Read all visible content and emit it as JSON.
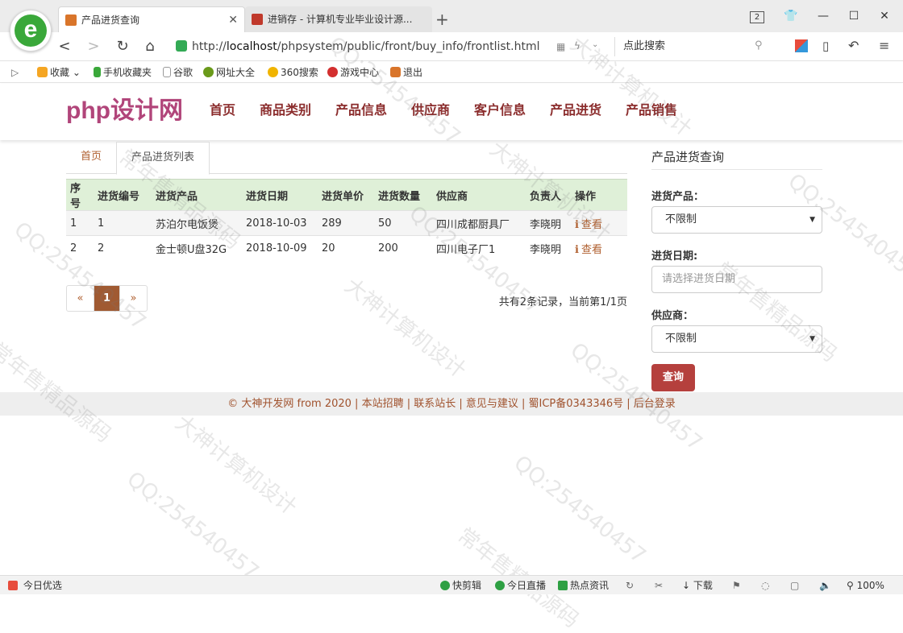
{
  "browser": {
    "tabs": [
      {
        "label": "产品进货查询",
        "favicon_color": "#d9752a"
      },
      {
        "label": "进销存 - 计算机专业毕业设计源...",
        "favicon_color": "#c0392b"
      }
    ],
    "new_tab_glyph": "+",
    "tab_count_badge": "2",
    "url_protocol": "http://",
    "url_host": "localhost",
    "url_path": "/phpsystem/public/front/buy_info/frontlist.html",
    "search_text": "点此搜索",
    "bookmarks": [
      {
        "label": "收藏",
        "icon": "star-icon",
        "color": "#f5a623"
      },
      {
        "label": "手机收藏夹",
        "icon": "phone-icon",
        "color": "#3aa83a"
      },
      {
        "label": "谷歌",
        "icon": "page-icon",
        "color": "#999999"
      },
      {
        "label": "网址大全",
        "icon": "globe-icon",
        "color": "#6a9a1a"
      },
      {
        "label": "360搜索",
        "icon": "search-360-icon",
        "color": "#f0b400"
      },
      {
        "label": "游戏中心",
        "icon": "game-icon",
        "color": "#d32f2f"
      },
      {
        "label": "退出",
        "icon": "exit-icon",
        "color": "#d9752a"
      }
    ]
  },
  "site": {
    "logo": "php设计网",
    "nav": [
      "首页",
      "商品类别",
      "产品信息",
      "供应商",
      "客户信息",
      "产品进货",
      "产品销售"
    ]
  },
  "breadcrumb": {
    "home": "首页",
    "current": "产品进货列表"
  },
  "table": {
    "headers": [
      "序号",
      "进货编号",
      "进货产品",
      "进货日期",
      "进货单价",
      "进货数量",
      "供应商",
      "负责人",
      "操作"
    ],
    "rows": [
      {
        "no": "1",
        "code": "1",
        "product": "苏泊尔电饭煲",
        "date": "2018-10-03",
        "price": "289",
        "qty": "50",
        "supplier": "四川成都厨具厂",
        "manager": "李晓明",
        "action": "查看"
      },
      {
        "no": "2",
        "code": "2",
        "product": "金士顿U盘32G",
        "date": "2018-10-09",
        "price": "20",
        "qty": "200",
        "supplier": "四川电子厂1",
        "manager": "李晓明",
        "action": "查看"
      }
    ]
  },
  "pager": {
    "prev": "«",
    "current": "1",
    "next": "»",
    "info": "共有2条记录，当前第1/1页"
  },
  "sidebar": {
    "title": "产品进货查询",
    "product_label": "进货产品：",
    "product_value": "不限制",
    "date_label": "进货日期:",
    "date_placeholder": "请选择进货日期",
    "supplier_label": "供应商：",
    "supplier_value": "不限制",
    "search_button": "查询"
  },
  "footer": "© 大神开发网 from 2020 | 本站招聘 | 联系站长 | 意见与建议 | 蜀ICP备0343346号 | 后台登录",
  "watermarks": [
    "QQ:254540457",
    "大神计算机设计",
    "常年售精品源码"
  ],
  "statusbar": {
    "left": "今日优选",
    "items": [
      "快剪辑",
      "今日直播",
      "热点资讯",
      "下载"
    ],
    "zoom": "100%"
  }
}
